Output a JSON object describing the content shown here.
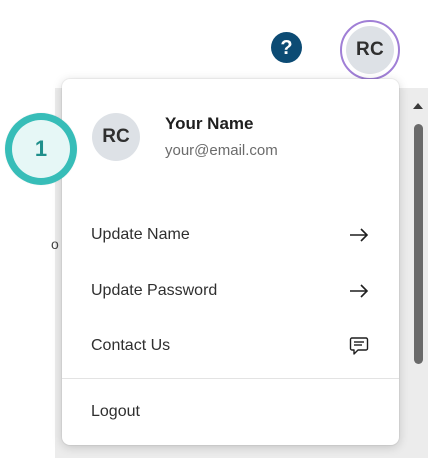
{
  "header": {
    "help_glyph": "?",
    "avatar_initials": "RC",
    "avatar_border_color": "#a07fd6",
    "help_color": "#0c4b74"
  },
  "step": {
    "number": "1",
    "color": "#37bdb8"
  },
  "profile": {
    "initials": "RC",
    "name": "Your Name",
    "email": "your@email.com"
  },
  "background": {
    "peek_text": "o"
  },
  "menu": {
    "items": [
      {
        "label": "Update Name",
        "icon": "arrow-right-icon"
      },
      {
        "label": "Update Password",
        "icon": "arrow-right-icon"
      },
      {
        "label": "Contact Us",
        "icon": "chat-icon"
      }
    ],
    "logout_label": "Logout"
  }
}
